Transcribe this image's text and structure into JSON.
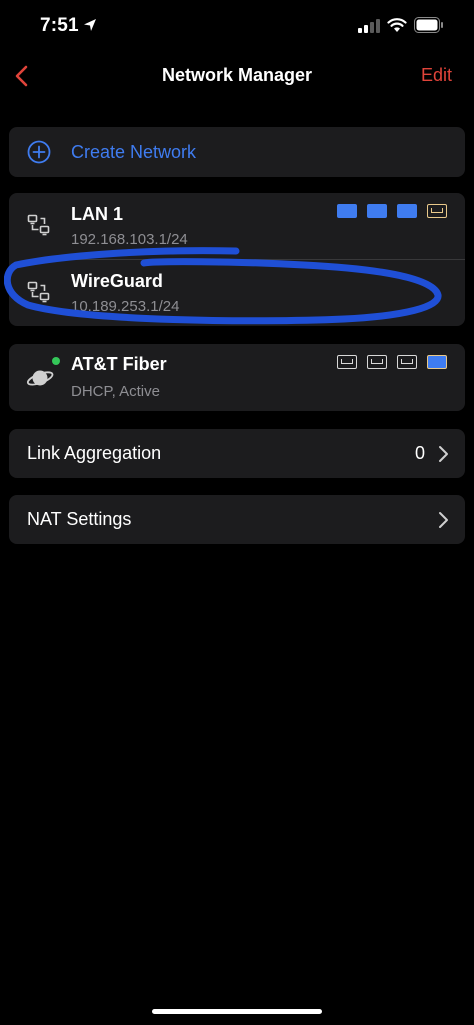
{
  "status_bar": {
    "time": "7:51",
    "icons": [
      "location-arrow-icon",
      "cellular-signal-icon",
      "wifi-icon",
      "battery-icon"
    ]
  },
  "nav": {
    "back_icon": "chevron-left-icon",
    "title": "Network Manager",
    "edit_label": "Edit"
  },
  "create": {
    "icon": "plus-circle-icon",
    "label": "Create Network"
  },
  "networks": [
    {
      "name": "LAN 1",
      "subnet": "192.168.103.1/24",
      "icon": "lan-network-icon",
      "ports": [
        "filled",
        "filled",
        "filled",
        "outline-amber"
      ]
    },
    {
      "name": "WireGuard",
      "subnet": "10.189.253.1/24",
      "icon": "lan-network-icon",
      "ports": []
    }
  ],
  "wan": {
    "name": "AT&T Fiber",
    "status": "DHCP, Active",
    "icon": "planet-icon",
    "status_color": "#34c759",
    "ports": [
      "outline",
      "outline",
      "outline",
      "filled"
    ]
  },
  "link_aggregation": {
    "label": "Link Aggregation",
    "count": "0"
  },
  "nat_settings": {
    "label": "NAT Settings"
  },
  "colors": {
    "accent_blue": "#3f7cf0",
    "edit_red": "#e0443a",
    "card_bg": "#1c1c1e",
    "subtext": "#8e8e93",
    "highlight_stroke": "#1f4fd6"
  }
}
